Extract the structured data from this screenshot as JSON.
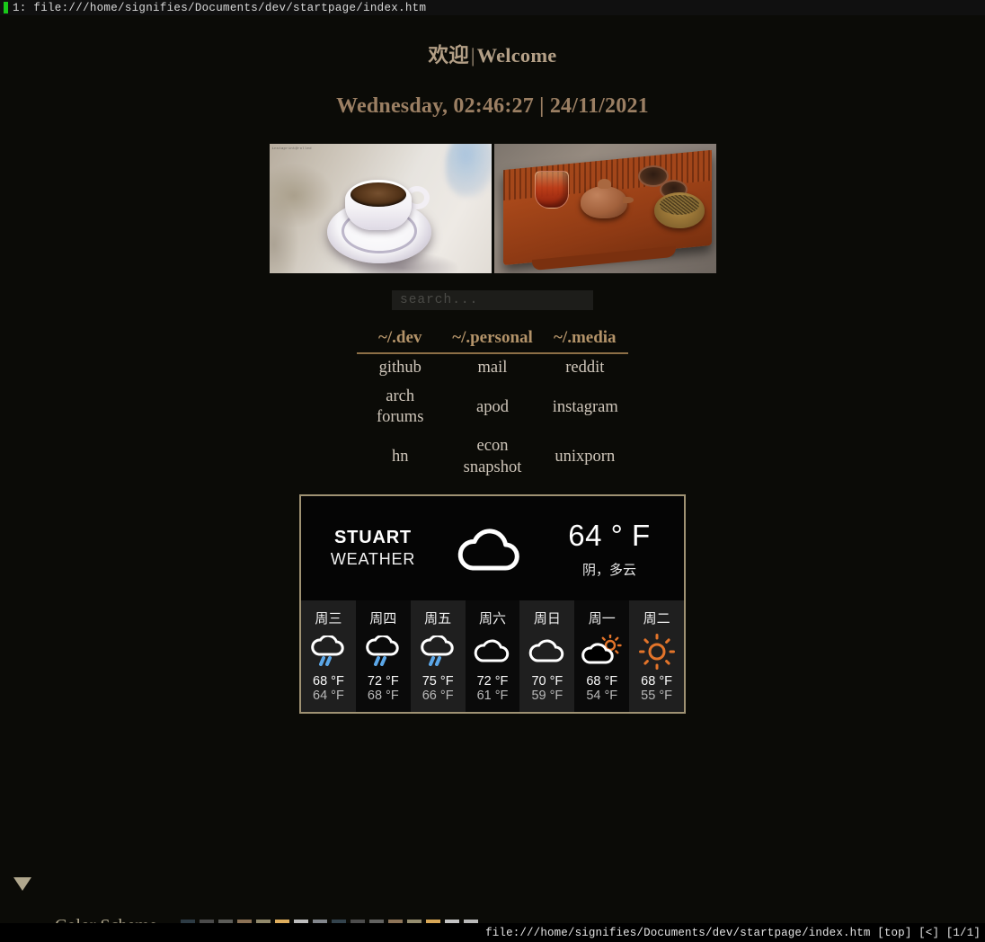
{
  "terminal": {
    "tab_label": "1: file:///home/signifies/Documents/dev/startpage/index.htm",
    "status_line": "file:///home/signifies/Documents/dev/startpage/index.htm [top] [<] [1/1]"
  },
  "header": {
    "welcome_cn": "欢迎",
    "welcome_sep": "|",
    "welcome_en": "Welcome",
    "datetime": "Wednesday, 02:46:27 | 24/11/2021"
  },
  "images": [
    {
      "name": "coffee-cup-photo",
      "watermark": "instaprint@rolled"
    },
    {
      "name": "chinese-tea-set-photo",
      "watermark": ""
    }
  ],
  "search": {
    "placeholder": "search...",
    "value": ""
  },
  "links": {
    "columns": [
      "~/.dev",
      "~/.personal",
      "~/.media"
    ],
    "rows": [
      [
        "github",
        "mail",
        "reddit"
      ],
      [
        "arch forums",
        "apod",
        "instagram"
      ],
      [
        "hn",
        "econ snapshot",
        "unixporn"
      ]
    ]
  },
  "weather": {
    "city_line1": "STUART",
    "city_line2": "WEATHER",
    "current_icon": "cloud-icon",
    "current_temp": "64 ° F",
    "current_desc": "阴，多云",
    "forecast": [
      {
        "day": "周三",
        "icon": "rain-icon",
        "high": "68 °F",
        "low": "64 °F"
      },
      {
        "day": "周四",
        "icon": "rain-icon",
        "high": "72 °F",
        "low": "68 °F"
      },
      {
        "day": "周五",
        "icon": "rain-icon",
        "high": "75 °F",
        "low": "66 °F"
      },
      {
        "day": "周六",
        "icon": "cloud-icon",
        "high": "72 °F",
        "low": "61 °F"
      },
      {
        "day": "周日",
        "icon": "cloud-icon",
        "high": "70 °F",
        "low": "59 °F"
      },
      {
        "day": "周一",
        "icon": "cloud-sun-icon",
        "high": "68 °F",
        "low": "54 °F"
      },
      {
        "day": "周二",
        "icon": "sun-icon",
        "high": "68 °F",
        "low": "55 °F"
      }
    ]
  },
  "footer": {
    "scheme_label": "Color Scheme",
    "swatches": [
      "#2d3b44",
      "#4a4a4a",
      "#5c5c58",
      "#8b7155",
      "#91896b",
      "#dfae5d",
      "#bdbdbd",
      "#82868c",
      "#33434d",
      "#4c4c4c",
      "#626260",
      "#8d7458",
      "#958d6f",
      "#d9a857",
      "#c4c4c4",
      "#b9b9b9"
    ]
  }
}
